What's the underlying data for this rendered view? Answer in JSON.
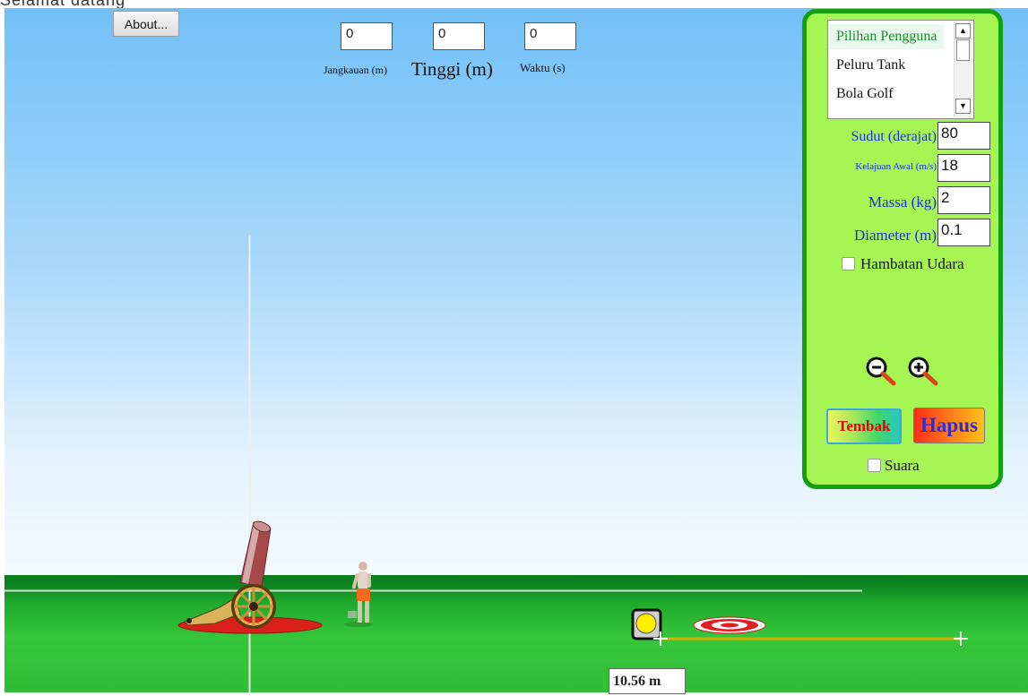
{
  "top_strip": {
    "clipped_text": "Selamat datang"
  },
  "about_button": {
    "label": "About..."
  },
  "readouts": {
    "range": {
      "value": "0",
      "label": "Jangkauan (m)"
    },
    "height": {
      "value": "0",
      "label": "Tinggi (m)"
    },
    "time": {
      "value": "0",
      "label": "Waktu (s)"
    }
  },
  "projectile_list": {
    "items": [
      "Pilihan Pengguna",
      "Peluru Tank",
      "Bola Golf"
    ],
    "selected_index": 0
  },
  "parameters": {
    "angle": {
      "label": "Sudut (derajat)",
      "value": "80"
    },
    "speed": {
      "label": "Kelajuan Awal (m/s)",
      "value": "18"
    },
    "mass": {
      "label": "Massa (kg)",
      "value": "2"
    },
    "diameter": {
      "label": "Diameter (m)",
      "value": "0.1"
    }
  },
  "air_resistance": {
    "label": "Hambatan Udara",
    "checked": false
  },
  "buttons": {
    "fire": "Tembak",
    "erase": "Hapus"
  },
  "sound": {
    "label": "Suara",
    "checked": false
  },
  "tape_measure": {
    "reading": "10.56 m"
  },
  "colors": {
    "panel_background": "#a6f653",
    "panel_border": "#13a00f",
    "label_blue": "#1d2de0",
    "sky_top": "#72c0f8",
    "ground": "#1ea92c"
  },
  "icons": [
    "zoom-out-icon",
    "zoom-in-icon",
    "cannon",
    "person-figure",
    "projectile-ball",
    "target",
    "crosshair-icon"
  ]
}
